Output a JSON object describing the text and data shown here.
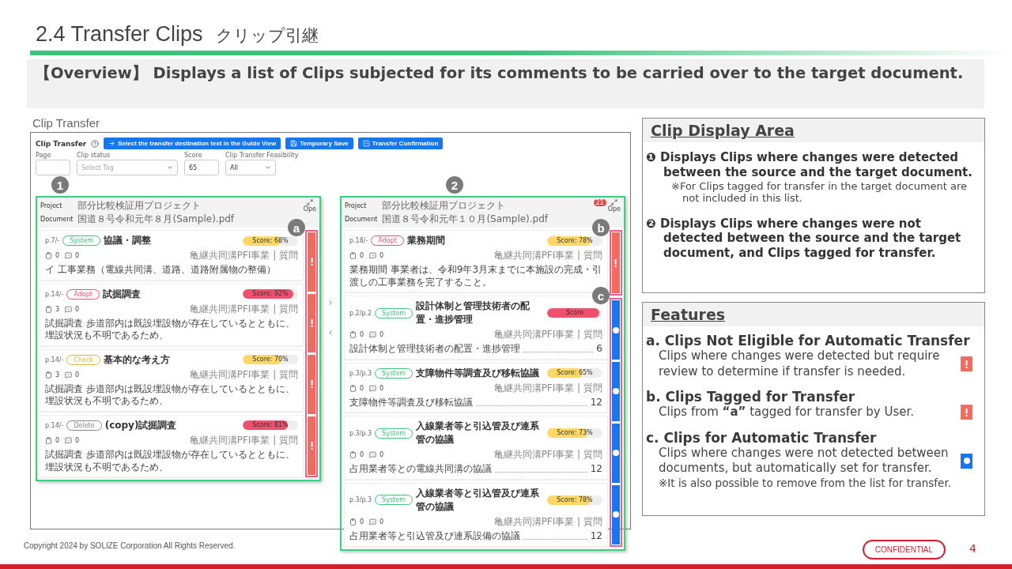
{
  "slide": {
    "title": "2.4 Transfer Clips",
    "subtitle": "クリップ引継",
    "overview": "【Overview】 Displays a list of Clips subjected for its comments to be carried over to the target document.",
    "screenshot_caption": "Clip Transfer"
  },
  "app": {
    "title": "Clip Transfer",
    "buttons": [
      {
        "kind": "arrow",
        "label": "Select the transfer destination text in the Guide View"
      },
      {
        "kind": "save",
        "label": "Temporary Save"
      },
      {
        "kind": "check",
        "label": "Transfer Confirmation"
      }
    ],
    "filters": [
      {
        "kind": "input",
        "label": "Page"
      },
      {
        "kind": "select",
        "label": "Clip status",
        "placeholder": "Select Tag"
      },
      {
        "kind": "input",
        "label": "Score",
        "value": "65"
      },
      {
        "kind": "select",
        "label": "Clip Transfer Feasibility",
        "value": "All"
      }
    ],
    "panels": [
      {
        "callout": "1",
        "project_label": "Project",
        "document_label": "Document",
        "project": "部分比較検証用プロジェクト",
        "document": "国道８号令和元年８月(Sample).pdf",
        "open_label": "Ope",
        "clips": [
          {
            "page": "p.7/-",
            "tag": {
              "label": "System",
              "color": "#3cc47a"
            },
            "title": "協議・調整",
            "meta": "亀継共同溝PFI事業 | 質問",
            "score": {
              "text": "Score: 68%",
              "level": 0.68,
              "color": "#ffd866"
            },
            "docs": "0",
            "comments": "0",
            "kind": "text",
            "body": "イ 工事業務（電線共同溝、道路、道路附属物の整備）"
          },
          {
            "page": "p.14/-",
            "tag": {
              "label": "Adopt",
              "color": "#f0506e"
            },
            "title": "試掘調査",
            "meta": "亀継共同溝PFI事業 | 質問",
            "score": {
              "text": "Score: 92%",
              "level": 0.92,
              "color": "#f0506e"
            },
            "docs": "3",
            "comments": "0",
            "kind": "text",
            "body": "試掘調査 歩道部内は既設埋設物が存在しているとともに、埋設状況も不明であるため、"
          },
          {
            "page": "p.14/-",
            "tag": {
              "label": "Check",
              "color": "#e0b63c"
            },
            "title": "基本的な考え方",
            "meta": "亀継共同溝PFI事業 | 質問",
            "score": {
              "text": "Score: 70%",
              "level": 0.7,
              "color": "#ffd866"
            },
            "docs": "3",
            "comments": "0",
            "kind": "text",
            "body": "試掘調査 歩道部内は既設埋設物が存在しているとともに、埋設状況も不明であるため、"
          },
          {
            "page": "p.14/-",
            "tag": {
              "label": "Delete",
              "color": "#888888"
            },
            "title": "(copy)試掘調査",
            "meta": "亀継共同溝PFI事業 | 質問",
            "score": {
              "text": "Score: 81%",
              "level": 0.81,
              "color": "#f0506e"
            },
            "docs": "0",
            "comments": "0",
            "kind": "text",
            "body": "試掘調査 歩道部内は既設埋設物が存在しているとともに、埋設状況も不明であるため、"
          }
        ],
        "marker_groups": [
          {
            "callout": "a",
            "markers": [
              {
                "kind": "review"
              },
              {
                "kind": "review"
              },
              {
                "kind": "review"
              },
              {
                "kind": "review"
              }
            ]
          }
        ]
      },
      {
        "callout": "2",
        "project_label": "Project",
        "document_label": "Document",
        "project": "部分比較検証用プロジェクト",
        "document": "国道８号令和元年１０月(Sample).pdf",
        "open_label": "Ope",
        "badge": "21",
        "clips": [
          {
            "page": "p.18/-",
            "tag": {
              "label": "Adopt",
              "color": "#f0506e"
            },
            "title": "業務期間",
            "meta": "亀継共同溝PFI事業 | 質問",
            "score": {
              "text": "Score: 78%",
              "level": 0.78,
              "color": "#ffd866"
            },
            "docs": "0",
            "comments": "0",
            "kind": "text",
            "body": "業務期間 事業者は、令和9年3月末までに本施設の完成・引渡しの工事業務を完了すること。"
          },
          {
            "page": "p.2/p.2",
            "tag": {
              "label": "System",
              "color": "#3cc47a"
            },
            "title": "設計体制と管理技術者の配置・進捗管理",
            "meta": "亀継共同溝PFI事業 | 質問",
            "score": {
              "text": "Score",
              "level": 0.95,
              "color": "#f0506e"
            },
            "docs": "0",
            "comments": "0",
            "kind": "toc",
            "body": "設計体制と管理技術者の配置・進捗管理",
            "page_ref": "6"
          },
          {
            "page": "p.3/p.3",
            "tag": {
              "label": "System",
              "color": "#3cc47a"
            },
            "title": "支障物件等調査及び移転協議",
            "meta": "亀継共同溝PFI事業 | 質問",
            "score": {
              "text": "Score: 65%",
              "level": 0.65,
              "color": "#ffd866"
            },
            "docs": "0",
            "comments": "0",
            "kind": "toc",
            "body": "支障物件等調査及び移転協議",
            "page_ref": "12"
          },
          {
            "page": "p.3/p.3",
            "tag": {
              "label": "System",
              "color": "#3cc47a"
            },
            "title": "入線業者等と引込管及び連系管の協議",
            "meta": "亀継共同溝PFI事業 | 質問",
            "score": {
              "text": "Score: 73%",
              "level": 0.73,
              "color": "#ffd866"
            },
            "docs": "0",
            "comments": "0",
            "kind": "toc",
            "body": "占用業者等との電線共同溝の協議",
            "page_ref": "12"
          },
          {
            "page": "p.3/p.3",
            "tag": {
              "label": "System",
              "color": "#3cc47a"
            },
            "title": "入線業者等と引込管及び連系管の協議",
            "meta": "亀継共同溝PFI事業 | 質問",
            "score": {
              "text": "Score: 78%",
              "level": 0.78,
              "color": "#ffd866"
            },
            "docs": "0",
            "comments": "0",
            "kind": "toc",
            "body": "占用業者等と引込管及び連系設備の協議",
            "page_ref": "12"
          }
        ],
        "marker_groups": [
          {
            "callout": "b",
            "markers": [
              {
                "kind": "review"
              }
            ]
          },
          {
            "callout": "c",
            "markers": [
              {
                "kind": "auto"
              },
              {
                "kind": "auto"
              },
              {
                "kind": "auto"
              },
              {
                "kind": "auto"
              }
            ]
          }
        ]
      }
    ]
  },
  "clip_display_area": {
    "title": "Clip Display Area",
    "items": [
      {
        "marker": "❶",
        "text": "Displays Clips where changes were detected between the source and the target document.",
        "note": "※For Clips tagged for transfer in the target document are not included in this list."
      },
      {
        "marker": "❷",
        "text": "Displays Clips where changes were not detected between the source and the target document, and Clips tagged for transfer."
      }
    ]
  },
  "features": {
    "title": "Features",
    "items": [
      {
        "label": "a. Clips Not Eligible for Automatic Transfer",
        "kind": "review",
        "description": "Clips where changes were detected but require review to determine if transfer is needed."
      },
      {
        "label": "b. Clips Tagged for Transfer",
        "kind": "review",
        "description": "Clips from **“a”** tagged for transfer by User."
      },
      {
        "label": "c.  Clips for Automatic Transfer",
        "kind": "auto",
        "description": "Clips where changes were not detected between documents, but automatically set for transfer.",
        "note": "※It is also possible to remove from the list for transfer."
      }
    ]
  },
  "footer": {
    "copyright": "Copyright 2024 by SOLIZE Corporation All Rights Reserved.",
    "confidential": "CONFIDENTIAL",
    "page": "4"
  }
}
